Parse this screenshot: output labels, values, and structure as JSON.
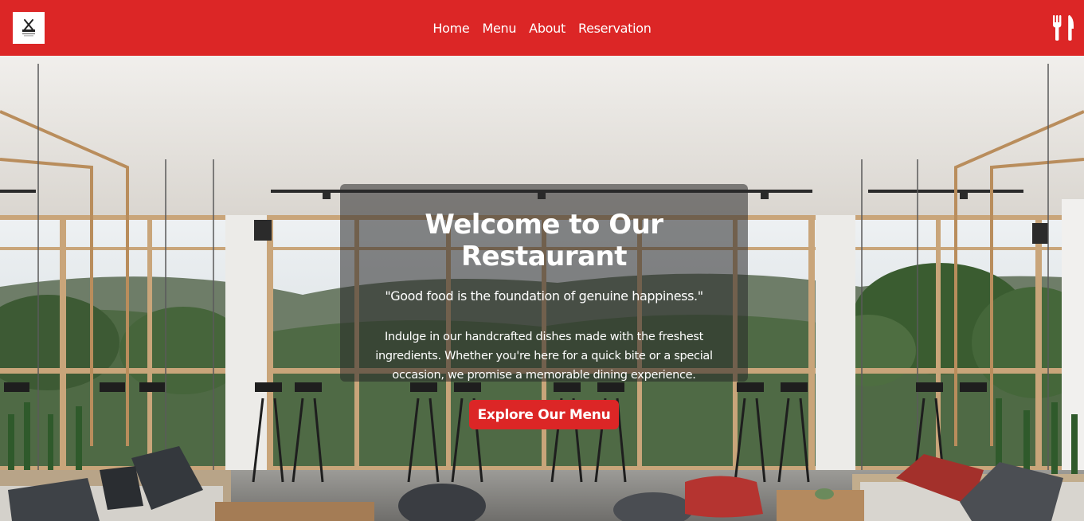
{
  "header": {
    "logo_icon": "restaurant-logo-icon",
    "nav": [
      {
        "label": "Home"
      },
      {
        "label": "Menu"
      },
      {
        "label": "About"
      },
      {
        "label": "Reservation"
      }
    ],
    "utility_icon": "fork-knife-icon"
  },
  "hero": {
    "background": "restaurant-interior-photo",
    "title": "Welcome to Our Restaurant",
    "quote": "\"Good food is the foundation of genuine happiness.\"",
    "description": "Indulge in our handcrafted dishes made with the freshest ingredients. Whether you're here for a quick bite or a special occasion, we promise a memorable dining experience.",
    "cta_label": "Explore Our Menu"
  },
  "colors": {
    "brand": "#dc2626",
    "text_on_brand": "#ffffff",
    "overlay": "rgba(40,40,40,0.55)"
  }
}
